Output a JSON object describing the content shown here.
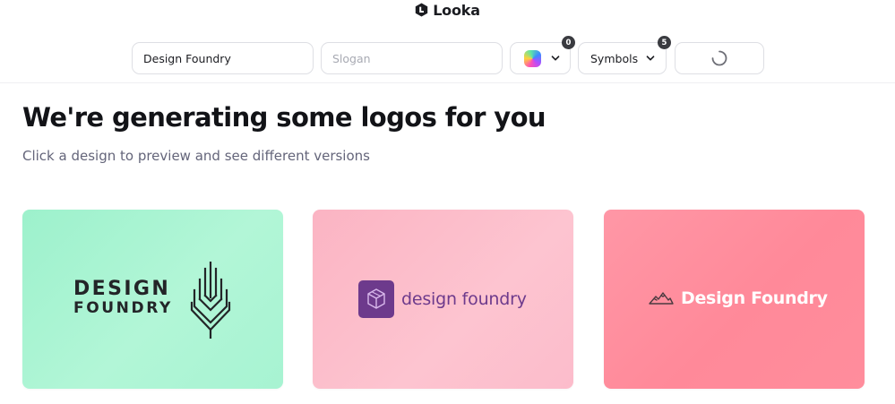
{
  "app": {
    "brand_name": "Looka",
    "brand_icon": "looka-logo-icon"
  },
  "toolbar": {
    "company_name_value": "Design Foundry",
    "slogan_placeholder": "Slogan",
    "color_selector": {
      "icon": "color-palette-swatch",
      "badge_count": "0"
    },
    "symbols_selector": {
      "label": "Symbols",
      "badge_count": "5"
    },
    "generate_button": {
      "state": "loading",
      "icon": "loading-spinner-icon"
    }
  },
  "main": {
    "heading": "We're generating some logos for you",
    "subheading": "Click a design to preview and see different versions"
  },
  "logo_cards": [
    {
      "background": "#a7f3d2",
      "name_line_1": "DESIGN",
      "name_line_2": "FOUNDRY",
      "text_color": "#232528",
      "icon": "wheat-stalk-icon"
    },
    {
      "background": "#fcbccb",
      "name": "design foundry",
      "text_color": "#6d3a8c",
      "icon": "hexagon-cube-badge-icon",
      "icon_color": "#6d3a8c"
    },
    {
      "background": "#ff8d9c",
      "name": "Design Foundry",
      "text_color": "#ffffff",
      "icon": "mountain-range-icon"
    }
  ]
}
